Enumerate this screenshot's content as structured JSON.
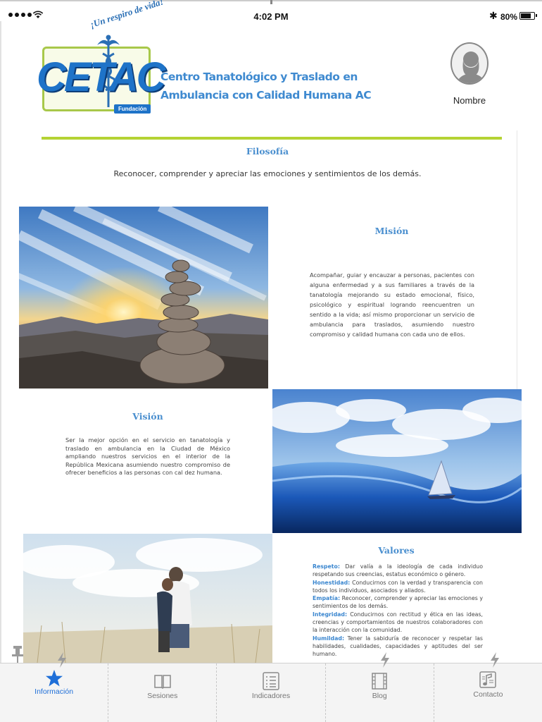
{
  "status_bar": {
    "time": "4:02 PM",
    "battery_text": "80%",
    "battery_level": 0.8,
    "bluetooth_glyph": "✱"
  },
  "logo": {
    "slogan": "¡Un respiro de vida!",
    "brand": "CETAC",
    "badge": "Fundación"
  },
  "header": {
    "org_name": "Centro Tanatológico y Traslado en Ambulancia con Calidad Humana AC",
    "user_name": "Nombre"
  },
  "filosofia": {
    "title": "Filosofía",
    "text": "Reconocer, comprender y apreciar las emociones y sentimientos de los demás."
  },
  "mision": {
    "title": "Misión",
    "text": "Acompañar, guiar y encauzar a personas, pacientes con alguna enfermedad y a sus familiares a través de la tanatología mejorando su estado emocional, físico, psicológico y espiritual logrando reencuentren un sentido a la vida; así mismo proporcionar un servicio de ambulancia para traslados, asumiendo nuestro compromiso y calidad humana con cada uno de ellos."
  },
  "vision": {
    "title": "Visión",
    "text": "Ser la mejor opción en el servicio en tanatología y traslado en ambulancia en la Ciudad de México ampliando nuestros servicios en el interior de la República Mexicana asumiendo nuestro compromiso de ofrecer beneficios a las personas con cal dez humana."
  },
  "valores": {
    "title": "Valores",
    "items": [
      {
        "key": "Respeto:",
        "text": "Dar valía a la ideología de cada individuo respetando sus creencias, estatus económico o género."
      },
      {
        "key": "Honestidad:",
        "text": "Conducirnos con la verdad y transparencia con todos los individuos, asociados y aliados."
      },
      {
        "key": "Empatía:",
        "text": "Reconocer, comprender y apreciar las emociones y sentimientos de los demás."
      },
      {
        "key": "Integridad:",
        "text": "Conducirnos con rectitud y ética en las ideas, creencias y comportamientos de nuestros colaboradores con la interacción con la comunidad."
      },
      {
        "key": "Humildad:",
        "text": "Tener la sabiduría de reconocer y respetar las habilidades, cualidades, capacidades y aptitudes del ser humano."
      }
    ]
  },
  "tabs": [
    {
      "label": "Información",
      "icon": "star-icon",
      "active": true
    },
    {
      "label": "Sesiones",
      "icon": "book-icon",
      "active": false
    },
    {
      "label": "Indicadores",
      "icon": "list-icon",
      "active": false
    },
    {
      "label": "Blog",
      "icon": "film-icon",
      "active": false
    },
    {
      "label": "Contacto",
      "icon": "music-note-icon",
      "active": false
    }
  ],
  "colors": {
    "accent_blue": "#1f6fd8",
    "title_blue": "#4a8fcf",
    "green_rule": "#b5d334"
  }
}
